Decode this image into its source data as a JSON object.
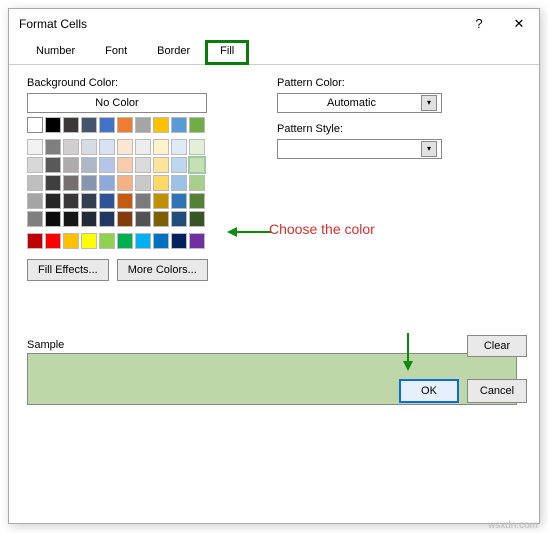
{
  "title": "Format Cells",
  "tabs": [
    "Number",
    "Font",
    "Border",
    "Fill"
  ],
  "activeTab": "Fill",
  "bgColorLabel": "Background Color:",
  "noColor": "No Color",
  "fillEffects": "Fill Effects...",
  "moreColors": "More Colors...",
  "patternColorLabel": "Pattern Color:",
  "patternColorValue": "Automatic",
  "patternStyleLabel": "Pattern Style:",
  "patternStyleValue": "",
  "sampleLabel": "Sample",
  "sampleColor": "#bdd7a8",
  "clear": "Clear",
  "ok": "OK",
  "cancel": "Cancel",
  "annotation": "Choose the color",
  "watermark": "wsxdn.com",
  "palette1": [
    "#ffffff",
    "#000000",
    "#3b3838",
    "#44546a",
    "#4472c4",
    "#ed7d31",
    "#a5a5a5",
    "#ffc000",
    "#5b9bd5",
    "#70ad47"
  ],
  "palette2": [
    "#f2f2f2",
    "#7f7f7f",
    "#d0cece",
    "#d6dce4",
    "#d9e2f3",
    "#fbe5d5",
    "#ededed",
    "#fff2cc",
    "#deebf6",
    "#e2efd9",
    "#d8d8d8",
    "#595959",
    "#aeabab",
    "#adb9ca",
    "#b4c6e7",
    "#f7cbac",
    "#dbdbdb",
    "#fee599",
    "#bdd7ee",
    "#c5e0b3",
    "#bfbfbf",
    "#3f3f3f",
    "#757070",
    "#8496b0",
    "#8eaadb",
    "#f4b183",
    "#c9c9c9",
    "#ffd965",
    "#9cc3e5",
    "#a8d08d",
    "#a5a5a5",
    "#262626",
    "#3a3838",
    "#323f4f",
    "#2f5496",
    "#c55a11",
    "#7b7b7b",
    "#bf9000",
    "#2e75b5",
    "#538135",
    "#7f7f7f",
    "#0c0c0c",
    "#171616",
    "#222a35",
    "#1f3864",
    "#833c0b",
    "#525252",
    "#7f6000",
    "#1e4e79",
    "#375623"
  ],
  "palette3": [
    "#c00000",
    "#ff0000",
    "#ffc000",
    "#ffff00",
    "#92d050",
    "#00b050",
    "#00b0f0",
    "#0070c0",
    "#002060",
    "#7030a0"
  ]
}
